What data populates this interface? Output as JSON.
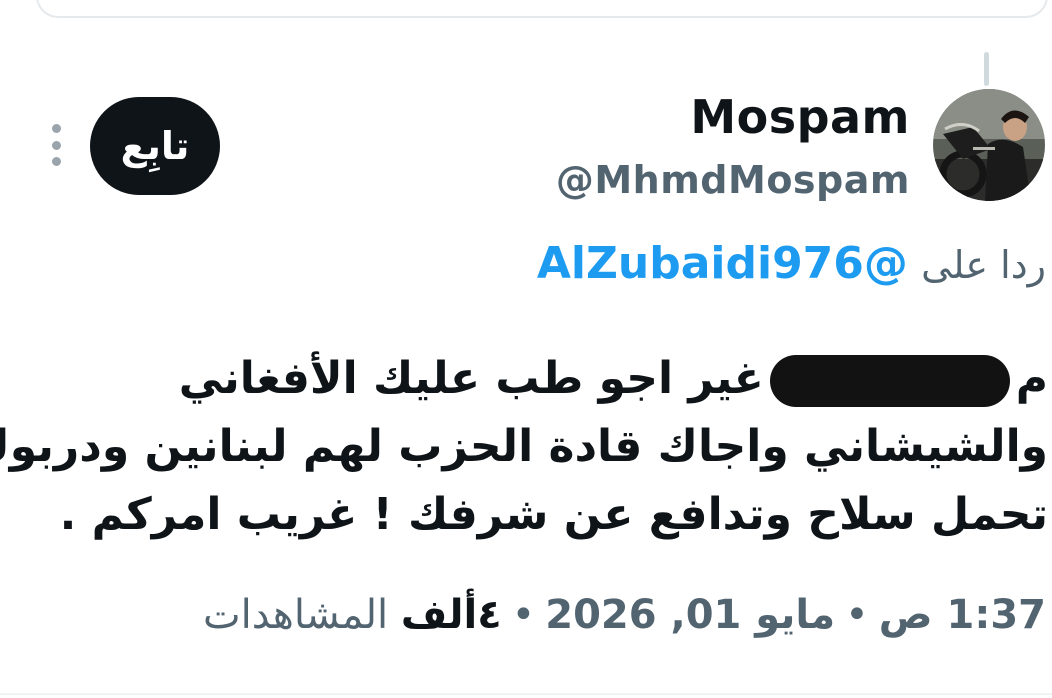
{
  "author": {
    "display_name": "Mospam",
    "handle": "@MhmdMospam",
    "avatar_icon": "avatar-photo-motorcycle"
  },
  "actions": {
    "follow_label": "تابِع",
    "more_icon": "more-vertical-icon"
  },
  "reply": {
    "prefix": "ردا على",
    "mention": "@AlZubaidi976"
  },
  "tweet": {
    "lines": [
      {
        "before_redaction": "م",
        "after_redaction": "غير اجو طب عليك الأفغاني"
      },
      {
        "text": "والشيشاني واجاك قادة الحزب لهم لبنانين ودربوك"
      },
      {
        "text": "تحمل سلاح وتدافع عن شرفك ! غريب امركم ."
      }
    ]
  },
  "meta": {
    "time": "1:37 ص",
    "date": "مايو 01, 2026",
    "views_count": "٤ألف",
    "views_label": "المشاهدات",
    "separator": "•"
  },
  "colors": {
    "text": "#0f1419",
    "secondary": "#536471",
    "link": "#1d9bf0",
    "button_bg": "#0f1419",
    "button_text": "#ffffff"
  }
}
